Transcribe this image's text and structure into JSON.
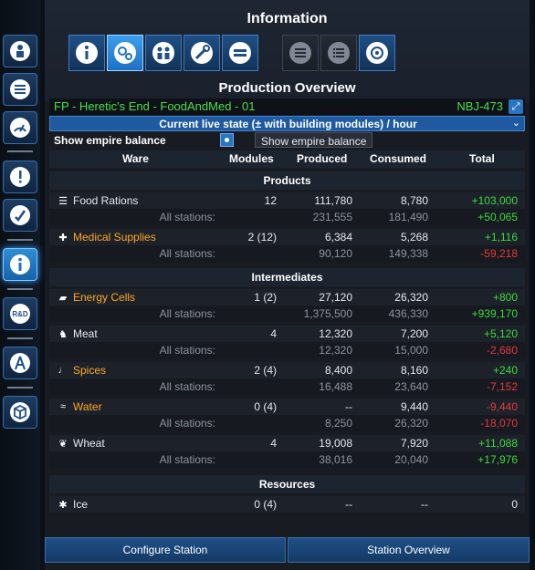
{
  "header": {
    "title": "Information",
    "subtitle": "Production Overview"
  },
  "station": {
    "name": "FP - Heretic's End - FoodAndMed - 01",
    "code": "NBJ-473"
  },
  "mode": {
    "label": "Current live state (± with building modules) / hour"
  },
  "balance": {
    "label": "Show empire balance",
    "checked": true,
    "tooltip": "Show empire balance"
  },
  "columns": {
    "ware": "Ware",
    "modules": "Modules",
    "produced": "Produced",
    "consumed": "Consumed",
    "total": "Total"
  },
  "sections": {
    "products": "Products",
    "intermediates": "Intermediates",
    "resources": "Resources"
  },
  "all_stations_label": "All stations:",
  "rows": {
    "food": {
      "icon": "food-rations-icon",
      "name": "Food Rations",
      "modules": "12",
      "produced": "111,780",
      "consumed": "8,780",
      "total": "+103,000",
      "all_produced": "231,555",
      "all_consumed": "181,490",
      "all_total": "+50,065"
    },
    "med": {
      "icon": "medical-supplies-icon",
      "name": "Medical Supplies",
      "modules": "2 (12)",
      "produced": "6,384",
      "consumed": "5,268",
      "total": "+1,116",
      "all_produced": "90,120",
      "all_consumed": "149,338",
      "all_total": "-59,218"
    },
    "energy": {
      "icon": "energy-cells-icon",
      "name": "Energy Cells",
      "modules": "1 (2)",
      "produced": "27,120",
      "consumed": "26,320",
      "total": "+800",
      "all_produced": "1,375,500",
      "all_consumed": "436,330",
      "all_total": "+939,170"
    },
    "meat": {
      "icon": "meat-icon",
      "name": "Meat",
      "modules": "4",
      "produced": "12,320",
      "consumed": "7,200",
      "total": "+5,120",
      "all_produced": "12,320",
      "all_consumed": "15,000",
      "all_total": "-2,680"
    },
    "spices": {
      "icon": "spices-icon",
      "name": "Spices",
      "modules": "2 (4)",
      "produced": "8,400",
      "consumed": "8,160",
      "total": "+240",
      "all_produced": "16,488",
      "all_consumed": "23,640",
      "all_total": "-7,152"
    },
    "water": {
      "icon": "water-icon",
      "name": "Water",
      "modules": "0 (4)",
      "produced": "--",
      "consumed": "9,440",
      "total": "-9,440",
      "all_produced": "8,250",
      "all_consumed": "26,320",
      "all_total": "-18,070"
    },
    "wheat": {
      "icon": "wheat-icon",
      "name": "Wheat",
      "modules": "4",
      "produced": "19,008",
      "consumed": "7,920",
      "total": "+11,088",
      "all_produced": "38,016",
      "all_consumed": "20,040",
      "all_total": "+17,976"
    },
    "ice": {
      "icon": "ice-icon",
      "name": "Ice",
      "modules": "0 (4)",
      "produced": "--",
      "consumed": "--",
      "total": "0"
    }
  },
  "buttons": {
    "configure": "Configure Station",
    "overview": "Station Overview"
  },
  "colors": {
    "positive": "#3fd93f",
    "negative": "#e23a3a",
    "highlight": "#ffa726",
    "station": "#4fdc4f",
    "accent": "#2a74c0"
  }
}
